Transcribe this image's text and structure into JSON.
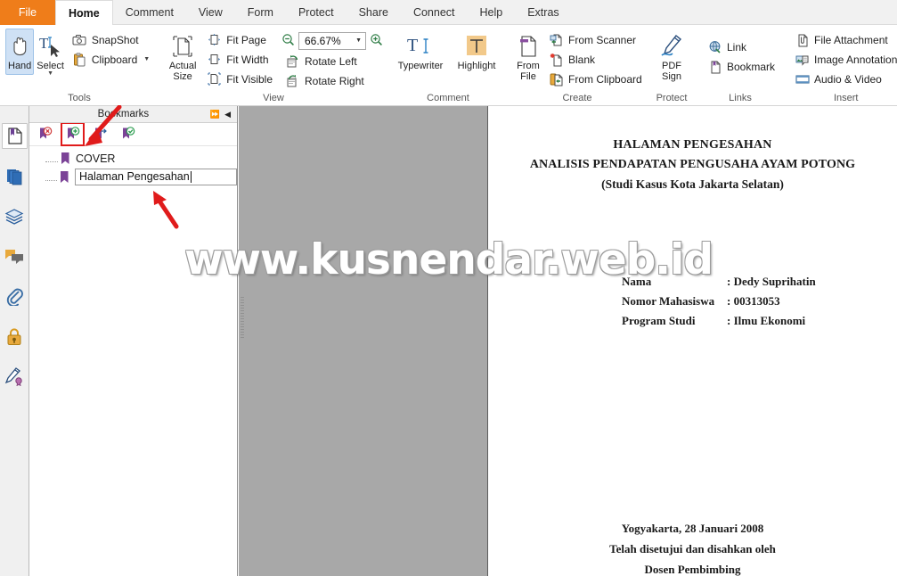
{
  "menu": {
    "items": [
      {
        "label": "File",
        "state": "file"
      },
      {
        "label": "Home",
        "state": "active"
      },
      {
        "label": "Comment",
        "state": "normal"
      },
      {
        "label": "View",
        "state": "normal"
      },
      {
        "label": "Form",
        "state": "normal"
      },
      {
        "label": "Protect",
        "state": "normal"
      },
      {
        "label": "Share",
        "state": "normal"
      },
      {
        "label": "Connect",
        "state": "normal"
      },
      {
        "label": "Help",
        "state": "normal"
      },
      {
        "label": "Extras",
        "state": "normal"
      }
    ]
  },
  "ribbon": {
    "tools": {
      "group_label": "Tools",
      "hand": "Hand",
      "select": "Select",
      "snapshot": "SnapShot",
      "clipboard": "Clipboard"
    },
    "view": {
      "group_label": "View",
      "actual_size_line1": "Actual",
      "actual_size_line2": "Size",
      "fit_page": "Fit Page",
      "fit_width": "Fit Width",
      "fit_visible": "Fit Visible",
      "rotate_left": "Rotate Left",
      "rotate_right": "Rotate Right",
      "zoom_value": "66.67%"
    },
    "comment": {
      "group_label": "Comment",
      "typewriter": "Typewriter",
      "highlight": "Highlight"
    },
    "create": {
      "group_label": "Create",
      "from_file_line1": "From",
      "from_file_line2": "File",
      "from_scanner": "From Scanner",
      "blank": "Blank",
      "from_clipboard": "From Clipboard"
    },
    "protect": {
      "group_label": "Protect",
      "pdf_sign_line1": "PDF",
      "pdf_sign_line2": "Sign"
    },
    "links": {
      "group_label": "Links",
      "link": "Link",
      "bookmark": "Bookmark"
    },
    "insert": {
      "group_label": "Insert",
      "file_attachment": "File Attachment",
      "image_annotation": "Image Annotation",
      "audio_video": "Audio & Video"
    }
  },
  "rail": {
    "items": [
      {
        "name": "bookmarks-panel-icon",
        "active": true
      },
      {
        "name": "pages-panel-icon",
        "active": false
      },
      {
        "name": "layers-panel-icon",
        "active": false
      },
      {
        "name": "comments-panel-icon",
        "active": false
      },
      {
        "name": "attachments-panel-icon",
        "active": false
      },
      {
        "name": "security-panel-icon",
        "active": false
      },
      {
        "name": "signatures-panel-icon",
        "active": false
      }
    ]
  },
  "bookmarks": {
    "title": "Bookmarks",
    "toolbar": [
      {
        "name": "delete-bookmark-icon",
        "highlighted": false
      },
      {
        "name": "add-bookmark-icon",
        "highlighted": true
      },
      {
        "name": "go-to-bookmark-icon",
        "highlighted": false
      },
      {
        "name": "edit-bookmark-icon",
        "highlighted": false
      }
    ],
    "items": [
      {
        "label": "COVER",
        "editing": false
      },
      {
        "label": "Halaman Pengesahan",
        "editing": true
      }
    ]
  },
  "document": {
    "title_line1": "HALAMAN PENGESAHAN",
    "title_line2": "ANALISIS PENDAPATAN PENGUSAHA AYAM POTONG",
    "title_line3": "(Studi Kasus Kota Jakarta Selatan)",
    "fields": [
      {
        "key": "Nama",
        "value": ": Dedy Suprihatin"
      },
      {
        "key": "Nomor Mahasiswa",
        "value": ": 00313053"
      },
      {
        "key": "Program Studi",
        "value": ": Ilmu Ekonomi"
      }
    ],
    "footer_line1": "Yogyakarta, 28 Januari 2008",
    "footer_line2": "Telah disetujui dan disahkan oleh",
    "footer_line3": "Dosen Pembimbing"
  },
  "watermark": {
    "text": "www.kusnendar.web.id"
  },
  "colors": {
    "accent_orange": "#ef7d1a",
    "annotation_red": "#e01b1b",
    "bookmark_purple": "#7b4397",
    "doc_background": "#a8a8a8"
  }
}
